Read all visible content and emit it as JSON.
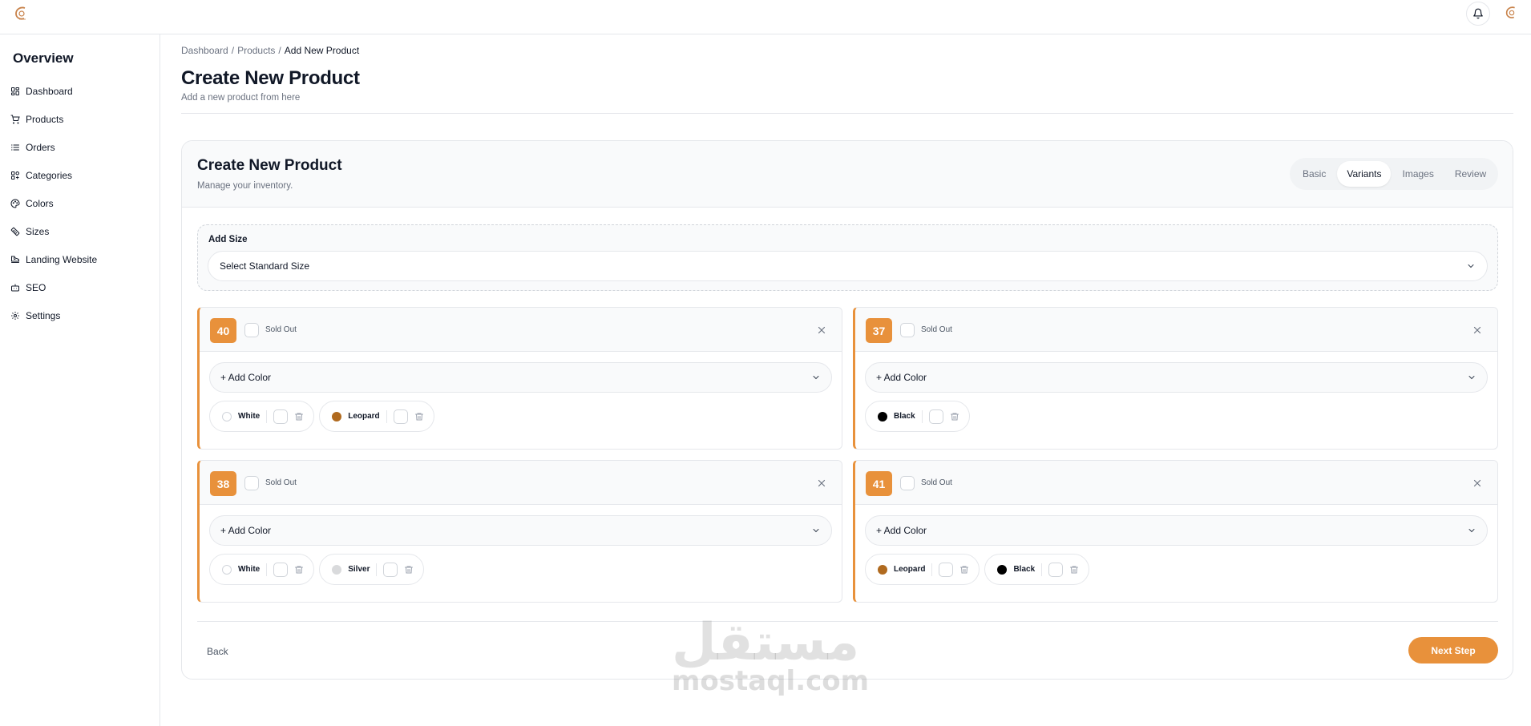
{
  "sidebar": {
    "title": "Overview",
    "items": [
      {
        "label": "Dashboard",
        "icon": "grid-icon"
      },
      {
        "label": "Products",
        "icon": "cart-icon"
      },
      {
        "label": "Orders",
        "icon": "list-icon"
      },
      {
        "label": "Categories",
        "icon": "categories-icon"
      },
      {
        "label": "Colors",
        "icon": "palette-icon"
      },
      {
        "label": "Sizes",
        "icon": "ruler-icon"
      },
      {
        "label": "Landing Website",
        "icon": "shoe-icon"
      },
      {
        "label": "SEO",
        "icon": "robot-icon"
      },
      {
        "label": "Settings",
        "icon": "gear-icon"
      }
    ]
  },
  "breadcrumb": [
    "Dashboard",
    "Products",
    "Add New Product"
  ],
  "page": {
    "title": "Create New Product",
    "subtitle": "Add a new product from here"
  },
  "card": {
    "title": "Create New Product",
    "subtitle": "Manage your inventory.",
    "tabs": [
      {
        "label": "Basic",
        "active": false
      },
      {
        "label": "Variants",
        "active": true
      },
      {
        "label": "Images",
        "active": false
      },
      {
        "label": "Review",
        "active": false
      }
    ]
  },
  "add_size": {
    "label": "Add Size",
    "select_value": "Select Standard Size"
  },
  "variants": [
    {
      "size": "40",
      "sold_out_label": "Sold Out",
      "add_color_label": "+ Add Color",
      "colors": [
        {
          "name": "White",
          "hex": "#ffffff"
        },
        {
          "name": "Leopard",
          "hex": "#b06a1f"
        }
      ]
    },
    {
      "size": "37",
      "sold_out_label": "Sold Out",
      "add_color_label": "+ Add Color",
      "colors": [
        {
          "name": "Black",
          "hex": "#000000"
        }
      ]
    },
    {
      "size": "38",
      "sold_out_label": "Sold Out",
      "add_color_label": "+ Add Color",
      "colors": [
        {
          "name": "White",
          "hex": "#ffffff"
        },
        {
          "name": "Silver",
          "hex": "#d9dadc"
        }
      ]
    },
    {
      "size": "41",
      "sold_out_label": "Sold Out",
      "add_color_label": "+ Add Color",
      "colors": [
        {
          "name": "Leopard",
          "hex": "#b06a1f"
        },
        {
          "name": "Black",
          "hex": "#000000"
        }
      ]
    }
  ],
  "footer": {
    "back_label": "Back",
    "next_label": "Next Step"
  },
  "watermark": {
    "arabic": "مستقل",
    "latin": "mostaql.com"
  },
  "colors": {
    "accent": "#e8913b",
    "border": "#e5e7eb",
    "muted_text": "#6b7280"
  }
}
